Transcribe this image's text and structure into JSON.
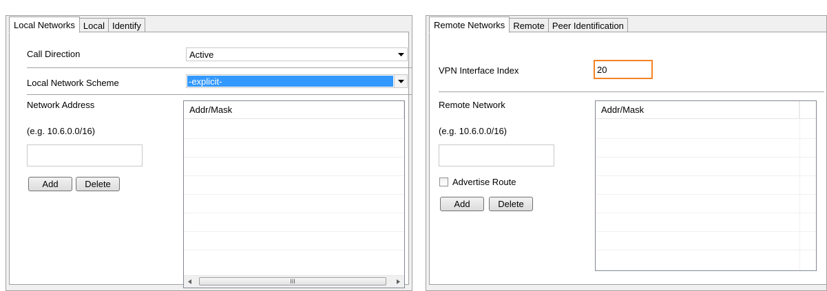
{
  "left_panel": {
    "tabs": [
      "Local Networks",
      "Local",
      "Identify"
    ],
    "active_tab": 0,
    "call_direction_label": "Call Direction",
    "call_direction_value": "Active",
    "scheme_label": "Local Network Scheme",
    "scheme_value": "-explicit-",
    "network_address_label": "Network Address",
    "example_text": "(e.g. 10.6.0.0/16)",
    "network_address_value": "",
    "add_label": "Add",
    "delete_label": "Delete",
    "list_header": "Addr/Mask",
    "scroll_grip": "III"
  },
  "right_panel": {
    "tabs": [
      "Remote Networks",
      "Remote",
      "Peer Identification"
    ],
    "active_tab": 0,
    "vpn_index_label": "VPN Interface Index",
    "vpn_index_value": "20",
    "remote_network_label": "Remote Network",
    "example_text": "(e.g. 10.6.0.0/16)",
    "remote_network_value": "",
    "advertise_route_label": "Advertise Route",
    "advertise_route_checked": false,
    "add_label": "Add",
    "delete_label": "Delete",
    "list_header": "Addr/Mask"
  },
  "colors": {
    "highlight": "#f58220",
    "selection": "#3399ff"
  }
}
